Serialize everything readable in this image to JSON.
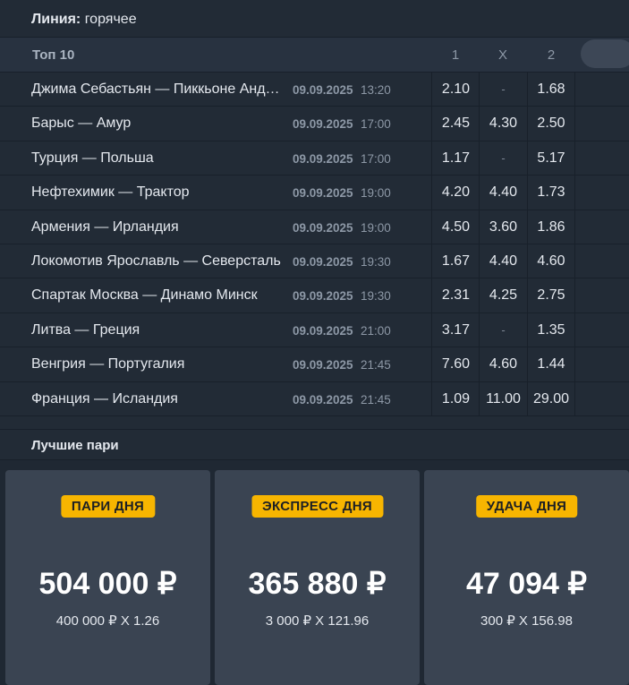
{
  "line": {
    "label": "Линия:",
    "value": "горячее"
  },
  "top": {
    "title": "Топ 10",
    "col1": "1",
    "colx": "X",
    "col2": "2"
  },
  "matches": [
    {
      "name": "Джима Себастьян — Пиккьоне Андреа",
      "date": "09.09.2025",
      "time": "13:20",
      "o1": "2.10",
      "ox": "-",
      "o2": "1.68"
    },
    {
      "name": "Барыс — Амур",
      "date": "09.09.2025",
      "time": "17:00",
      "o1": "2.45",
      "ox": "4.30",
      "o2": "2.50"
    },
    {
      "name": "Турция — Польша",
      "date": "09.09.2025",
      "time": "17:00",
      "o1": "1.17",
      "ox": "-",
      "o2": "5.17"
    },
    {
      "name": "Нефтехимик — Трактор",
      "date": "09.09.2025",
      "time": "19:00",
      "o1": "4.20",
      "ox": "4.40",
      "o2": "1.73"
    },
    {
      "name": "Армения — Ирландия",
      "date": "09.09.2025",
      "time": "19:00",
      "o1": "4.50",
      "ox": "3.60",
      "o2": "1.86"
    },
    {
      "name": "Локомотив Ярославль — Северсталь",
      "date": "09.09.2025",
      "time": "19:30",
      "o1": "1.67",
      "ox": "4.40",
      "o2": "4.60"
    },
    {
      "name": "Спартак Москва — Динамо Минск",
      "date": "09.09.2025",
      "time": "19:30",
      "o1": "2.31",
      "ox": "4.25",
      "o2": "2.75"
    },
    {
      "name": "Литва — Греция",
      "date": "09.09.2025",
      "time": "21:00",
      "o1": "3.17",
      "ox": "-",
      "o2": "1.35"
    },
    {
      "name": "Венгрия — Португалия",
      "date": "09.09.2025",
      "time": "21:45",
      "o1": "7.60",
      "ox": "4.60",
      "o2": "1.44"
    },
    {
      "name": "Франция — Исландия",
      "date": "09.09.2025",
      "time": "21:45",
      "o1": "1.09",
      "ox": "11.00",
      "o2": "29.00"
    }
  ],
  "best": {
    "title": "Лучшие пари",
    "cards": [
      {
        "badge": "ПАРИ ДНЯ",
        "amount": "504 000 ₽",
        "formula": "400 000 ₽ X 1.26"
      },
      {
        "badge": "ЭКСПРЕСС ДНЯ",
        "amount": "365 880 ₽",
        "formula": "3 000 ₽ X 121.96"
      },
      {
        "badge": "УДАЧА ДНЯ",
        "amount": "47 094 ₽",
        "formula": "300 ₽ X 156.98"
      }
    ]
  },
  "colors": {
    "accent": "#f7b500",
    "background": "#1f2833",
    "card": "#3a4452"
  }
}
